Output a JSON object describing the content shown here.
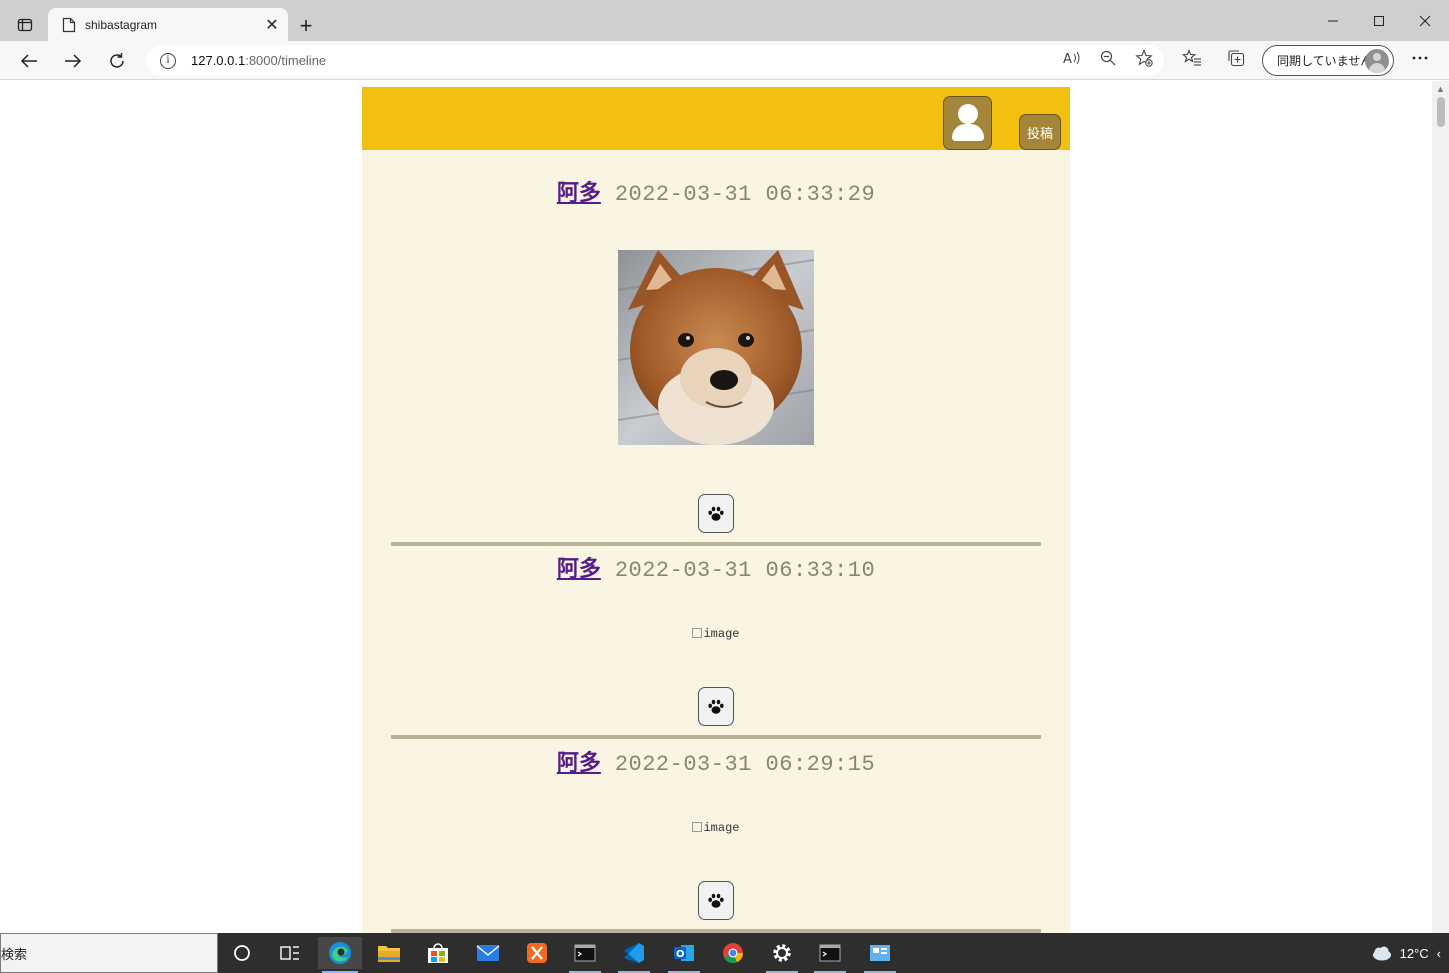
{
  "browser": {
    "tab_title": "shibastagram",
    "tab_close": "✕",
    "new_tab": "+",
    "url_host": "127.0.0.1",
    "url_path": ":8000/timeline",
    "sync_label": "同期していません",
    "window_controls": [
      "minimize-icon",
      "maximize-icon",
      "close-icon"
    ]
  },
  "header": {
    "profile_icon": "user-icon",
    "post_button": "投稿",
    "colors": {
      "header_bg": "#f3c012",
      "button_bg": "#a4863a",
      "page_bg": "#faf4e2"
    }
  },
  "posts": [
    {
      "user": "阿多",
      "time": "2022-03-31 06:33:29",
      "image": "shiba-puppy-photo",
      "like_icon": "paw-icon"
    },
    {
      "user": "阿多",
      "time": "2022-03-31 06:33:10",
      "image_alt": "image",
      "like_icon": "paw-icon"
    },
    {
      "user": "阿多",
      "time": "2022-03-31 06:29:15",
      "image_alt": "image",
      "like_icon": "paw-icon"
    }
  ],
  "taskbar": {
    "search_text": "検索",
    "weather": "12°C",
    "apps": [
      "cortana-icon",
      "task-view-icon",
      "edge-icon",
      "file-explorer-icon",
      "store-icon",
      "mail-icon",
      "xampp-icon",
      "terminal-icon",
      "vscode-icon",
      "outlook-icon",
      "chrome-icon",
      "settings-icon",
      "terminal-icon",
      "control-panel-icon"
    ]
  }
}
